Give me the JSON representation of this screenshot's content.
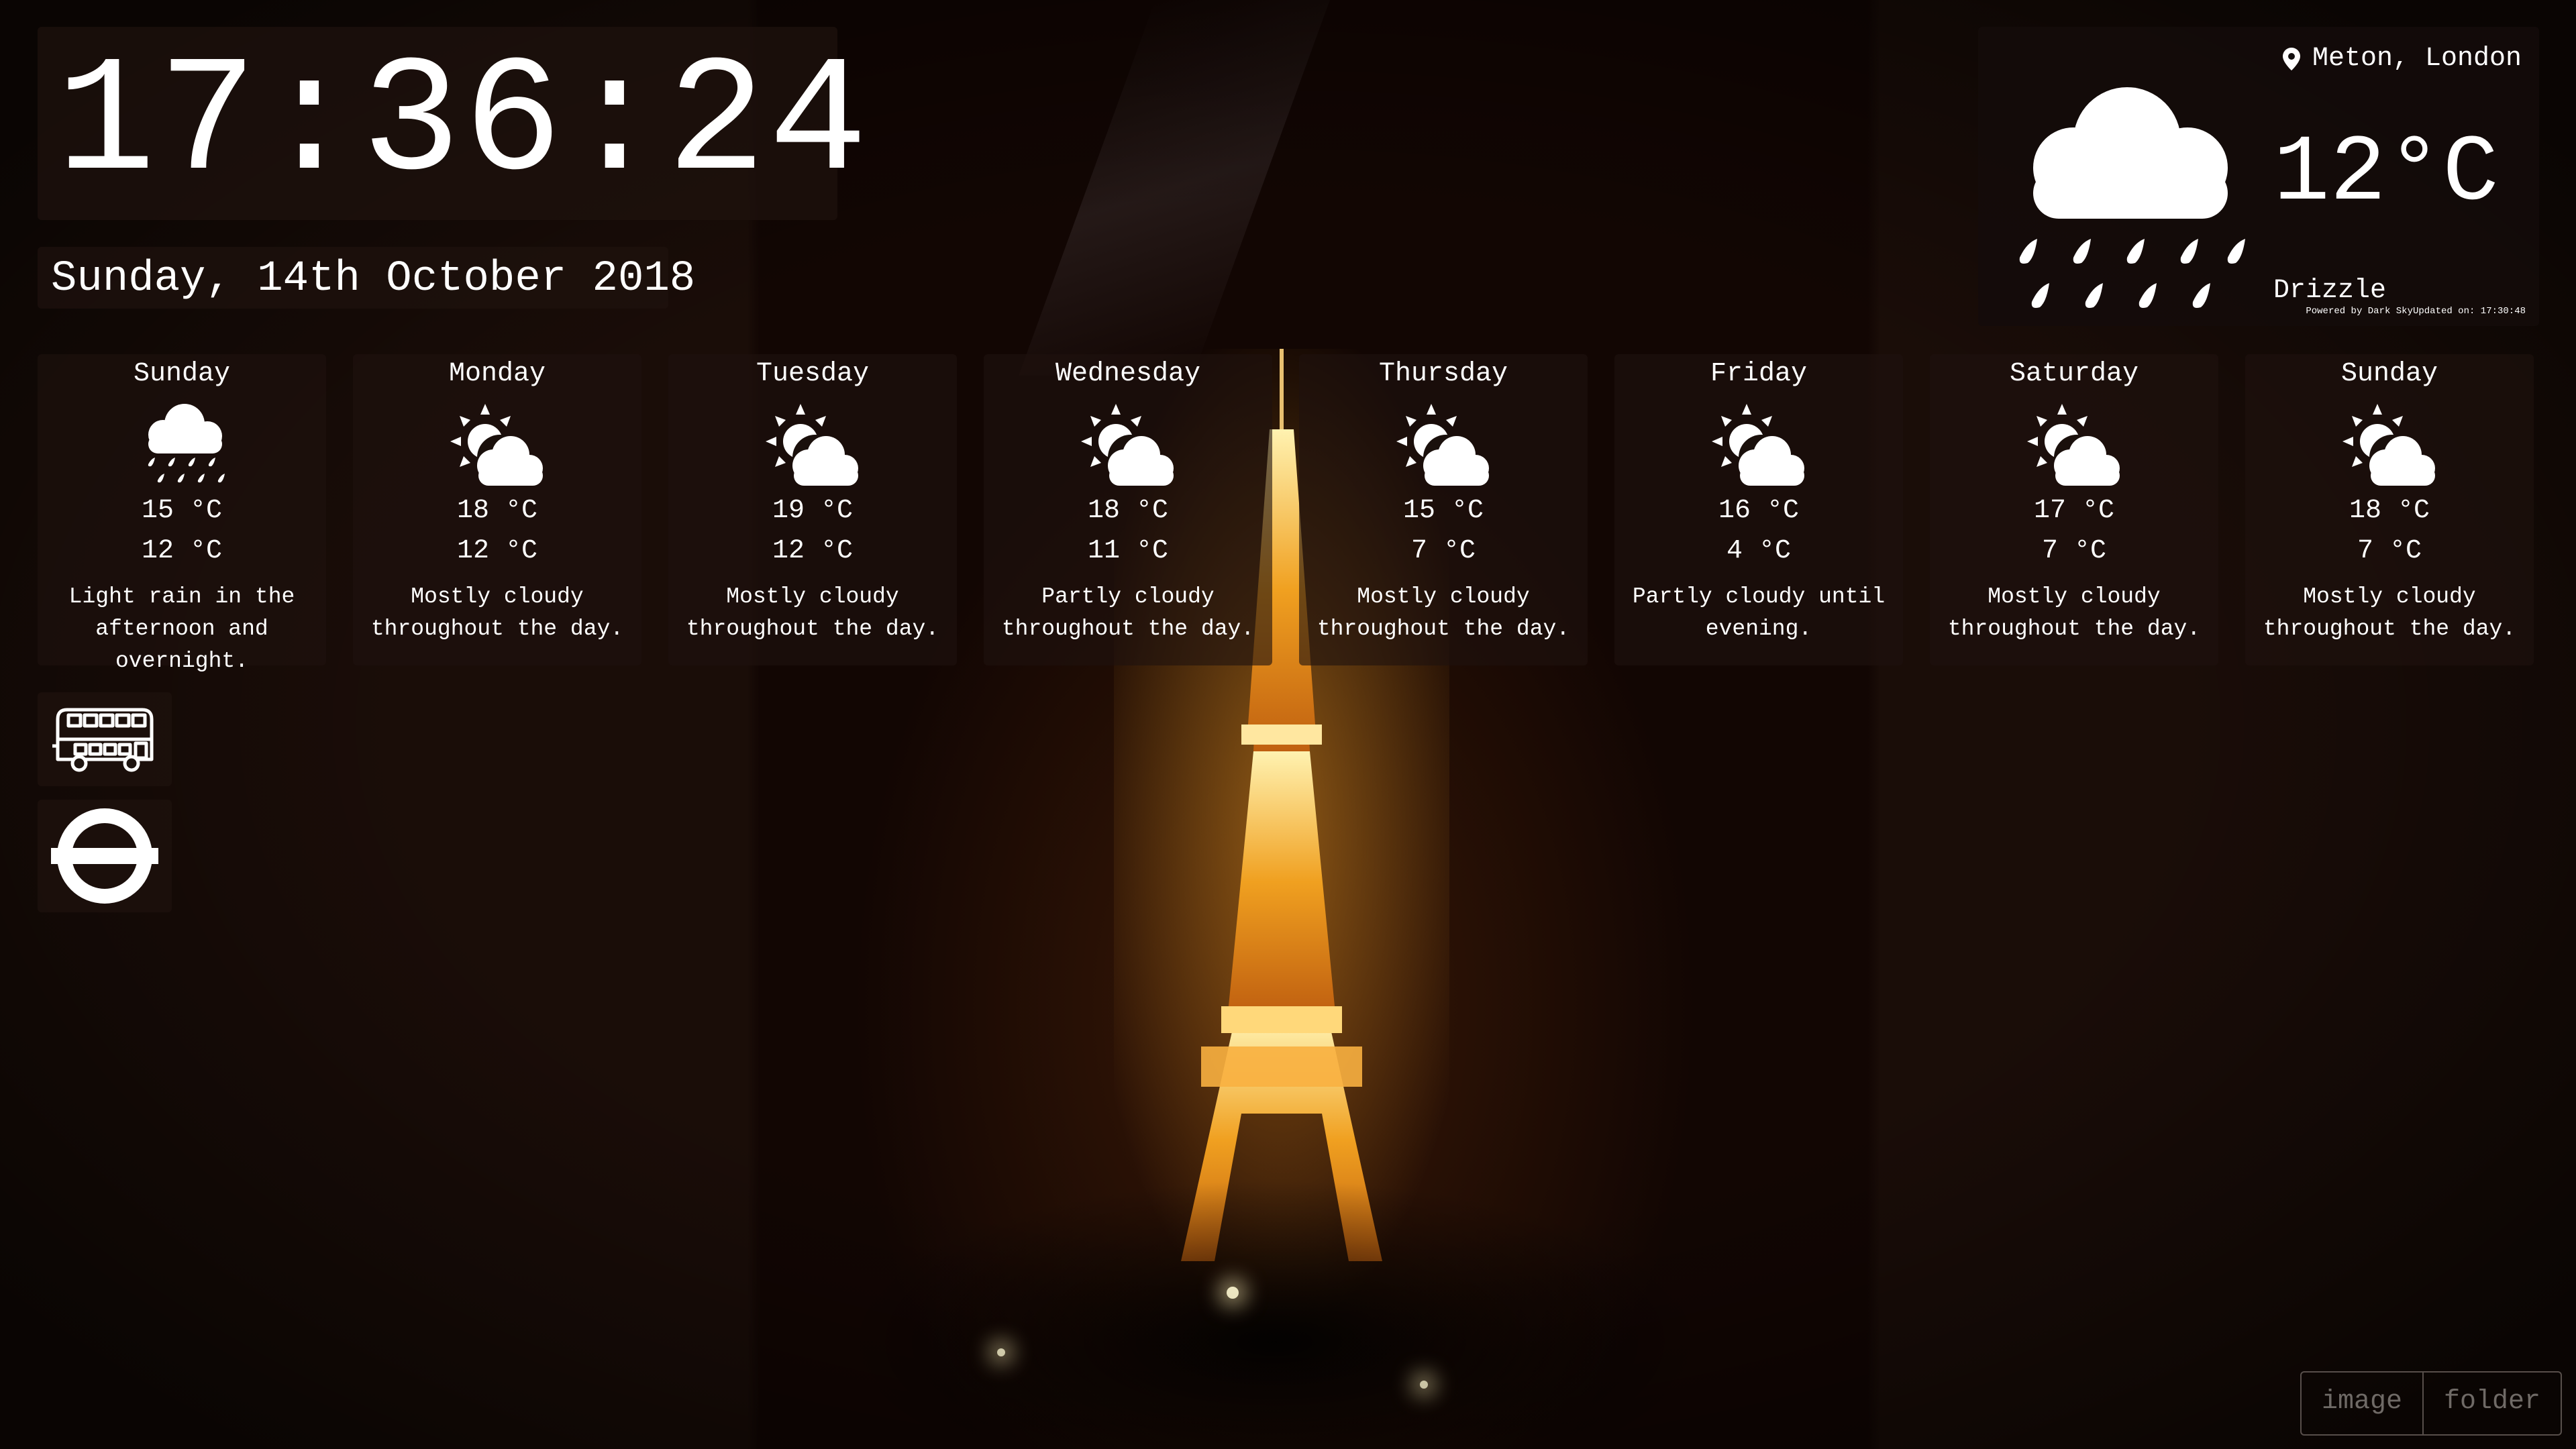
{
  "clock": {
    "time": "17:36:24"
  },
  "date": {
    "text": "Sunday, 14th October 2018"
  },
  "current": {
    "location": "Meton, London",
    "temperature": "12°C",
    "summary": "Drizzle",
    "footer": "Powered by Dark SkyUpdated on: 17:30:48",
    "icon": "rain-cloud-icon"
  },
  "forecast": [
    {
      "day": "Sunday",
      "hi": "15 °C",
      "lo": "12 °C",
      "summary": "Light rain in the afternoon and overnight.",
      "icon": "rain-icon"
    },
    {
      "day": "Monday",
      "hi": "18 °C",
      "lo": "12 °C",
      "summary": "Mostly cloudy throughout the day.",
      "icon": "partly-cloudy-icon"
    },
    {
      "day": "Tuesday",
      "hi": "19 °C",
      "lo": "12 °C",
      "summary": "Mostly cloudy throughout the day.",
      "icon": "partly-cloudy-icon"
    },
    {
      "day": "Wednesday",
      "hi": "18 °C",
      "lo": "11 °C",
      "summary": "Partly cloudy throughout the day.",
      "icon": "partly-cloudy-icon"
    },
    {
      "day": "Thursday",
      "hi": "15 °C",
      "lo": "7 °C",
      "summary": "Mostly cloudy throughout the day.",
      "icon": "partly-cloudy-icon"
    },
    {
      "day": "Friday",
      "hi": "16 °C",
      "lo": "4 °C",
      "summary": "Partly cloudy until evening.",
      "icon": "partly-cloudy-icon"
    },
    {
      "day": "Saturday",
      "hi": "17 °C",
      "lo": "7 °C",
      "summary": "Mostly cloudy throughout the day.",
      "icon": "partly-cloudy-icon"
    },
    {
      "day": "Sunday",
      "hi": "18 °C",
      "lo": "7 °C",
      "summary": "Mostly cloudy throughout the day.",
      "icon": "partly-cloudy-icon"
    }
  ],
  "transport": {
    "bus_icon": "bus-icon",
    "tube_icon": "underground-roundel-icon"
  },
  "background_toggle": {
    "options": [
      "image",
      "folder"
    ]
  }
}
